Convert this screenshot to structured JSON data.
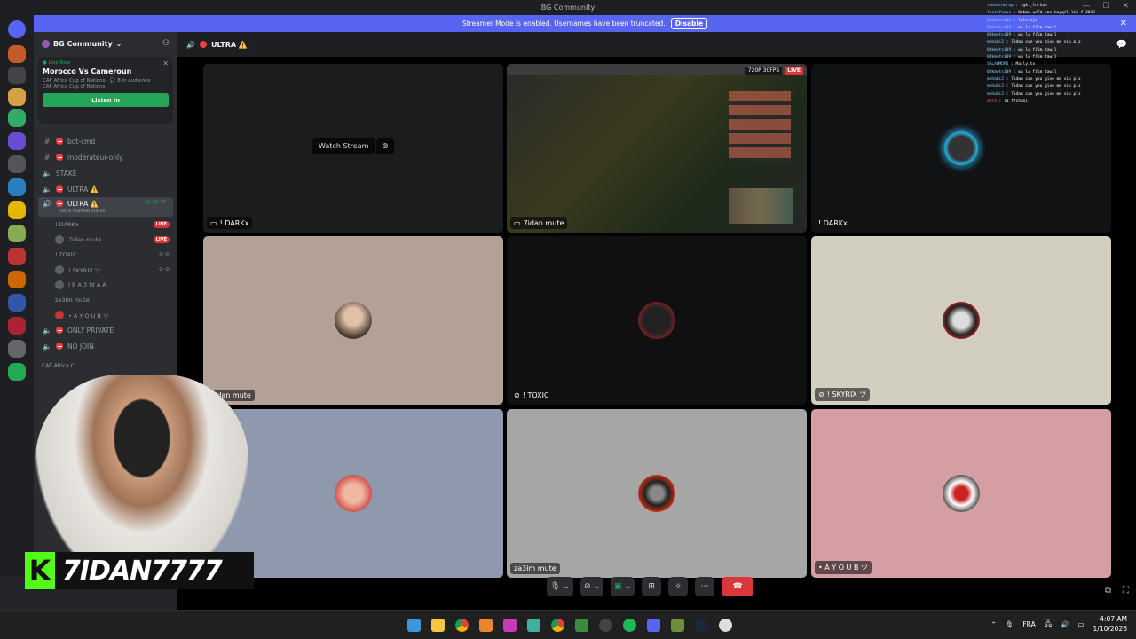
{
  "window": {
    "title": "BG Community"
  },
  "banner": {
    "text": "Streamer Mode is enabled. Usernames have been truncated.",
    "button": "Disable"
  },
  "server": {
    "name": "BG Community"
  },
  "live_event": {
    "status": "Live Now",
    "title": "Morocco Vs Cameroun",
    "meta1": "CAF Africa Cup of Nations",
    "audience": "8 in audience",
    "meta2": "CAF Africa Cup of Nations",
    "button": "Listen In"
  },
  "channels": [
    {
      "name": "bot-cmd",
      "icon": "#"
    },
    {
      "name": "modérateur-only",
      "icon": "#"
    },
    {
      "name": "STAKE",
      "icon": "🔊"
    },
    {
      "name": "ULTRA ⚠️",
      "icon": "🔊"
    }
  ],
  "active_channel": {
    "name": "ULTRA ⚠️",
    "time": "12:12:48",
    "status": "Set a channel status"
  },
  "voice_users": [
    {
      "name": "! DARKx",
      "badge": "LIVE"
    },
    {
      "name": "7idan mute",
      "badge": "LIVE"
    },
    {
      "name": "! TOXIC",
      "badge": ""
    },
    {
      "name": "! SKYRIX ツ",
      "badge": ""
    },
    {
      "name": "I B A 3 W A A",
      "badge": ""
    },
    {
      "name": "za3im mute",
      "badge": ""
    },
    {
      "name": "• A Y O U B ツ",
      "badge": ""
    }
  ],
  "channels_after": [
    {
      "name": "ONLY PRIVATE"
    },
    {
      "name": "NO JOIN"
    }
  ],
  "category": "CAF Africa C",
  "topbar": {
    "channel": "ULTRA ⚠️"
  },
  "tiles": [
    {
      "label": "! DARKx",
      "watch": "Watch Stream"
    },
    {
      "label": "7idan mute",
      "fps": "720P 30FPS",
      "live": "LIVE"
    },
    {
      "label": "! DARKx"
    },
    {
      "label": "7idan mute"
    },
    {
      "label": "! TOXIC"
    },
    {
      "label": "! SKYRIX ツ"
    },
    {
      "label": "A"
    },
    {
      "label": "za3im mute"
    },
    {
      "label": "• A Y O U B ツ"
    }
  ],
  "chat_lines": [
    {
      "user": "tomoktherap",
      "text": "rgkt_lnrhan"
    },
    {
      "user": "floidfaeus",
      "text": "Wabaa wa7d kan kayqil lik f 2019"
    },
    {
      "user": "0dkmotsi09",
      "text": "lalirnja"
    },
    {
      "user": "0dkmotsi09",
      "text": "wa la film tawil"
    },
    {
      "user": "0dkmotsi09",
      "text": "wa la film tawil"
    },
    {
      "user": "mohabi2",
      "text": "7idan can you give me vip plz"
    },
    {
      "user": "0dkmotsi09",
      "text": "wa la film tawil"
    },
    {
      "user": "0dkmotsi09",
      "text": "wa la film tawil"
    },
    {
      "user": "SALAHMDRD",
      "text": "Marlyito"
    },
    {
      "user": "0dkmotsi09",
      "text": "wa la film tawil"
    },
    {
      "user": "mohabi2",
      "text": "7idan can you give me vip plz"
    },
    {
      "user": "mohabi2",
      "text": "7idan can you give me vip plz"
    },
    {
      "user": "mohabi2",
      "text": "7idan can you give me vip plz"
    },
    {
      "user": "mdrd",
      "text": "la ffchani"
    }
  ],
  "streamer": {
    "logo_letter": "K",
    "name": "7IDAN7777"
  },
  "taskbar": {
    "lang": "FRA",
    "time": "4:07 AM",
    "date": "1/10/2026"
  }
}
